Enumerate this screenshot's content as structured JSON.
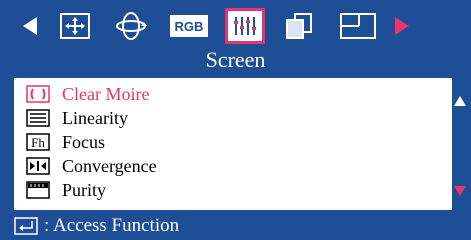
{
  "header": {
    "title": "Screen",
    "icons": [
      {
        "name": "arrow-left-icon"
      },
      {
        "name": "position-icon"
      },
      {
        "name": "rotation-icon"
      },
      {
        "name": "rgb-icon",
        "label": "RGB"
      },
      {
        "name": "screen-icon",
        "selected": true
      },
      {
        "name": "multi-window-icon"
      },
      {
        "name": "window-icon"
      },
      {
        "name": "arrow-right-icon"
      }
    ]
  },
  "menu": {
    "items": [
      {
        "label": "Clear Moire",
        "icon": "clear-moire-icon",
        "active": true
      },
      {
        "label": "Linearity",
        "icon": "linearity-icon"
      },
      {
        "label": "Focus",
        "icon": "focus-icon",
        "icon_text": "Fh"
      },
      {
        "label": "Convergence",
        "icon": "convergence-icon"
      },
      {
        "label": "Purity",
        "icon": "purity-icon"
      }
    ]
  },
  "footer": {
    "text": ": Access Function"
  },
  "colors": {
    "background": "#1e4e96",
    "accent": "#e8336e",
    "panel": "#ffffff"
  }
}
